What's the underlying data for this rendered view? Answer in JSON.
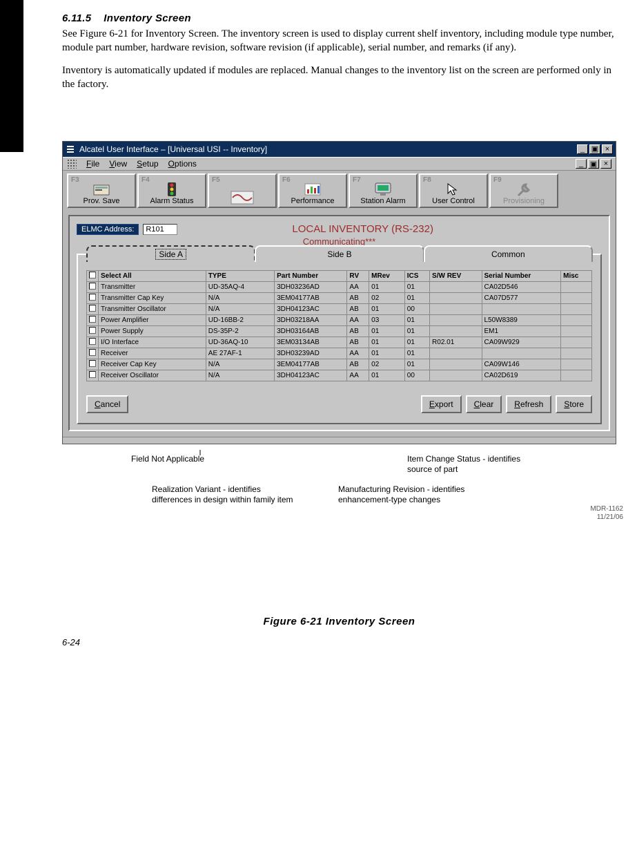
{
  "doc": {
    "section_num": "6.11.5",
    "section_title": "Inventory Screen",
    "para1": "See Figure 6-21 for Inventory Screen. The inventory screen is used to display current shelf inventory, including module type number, module part number, hardware revision, software revision (if applicable), serial number, and remarks (if any).",
    "para2": "Inventory is automatically updated if modules are replaced. Manual changes to the inventory list on the screen are performed only in the factory.",
    "figure_caption": "Figure 6-21  Inventory Screen",
    "page_number": "6-24",
    "mdr_ref": "MDR-1162",
    "mdr_date": "11/21/06"
  },
  "window": {
    "title": "Alcatel User Interface – [Universal USI -- Inventory]",
    "menus": {
      "file": "File",
      "view": "View",
      "setup": "Setup",
      "options": "Options"
    },
    "toolbar": [
      {
        "fkey": "F3",
        "label": "Prov. Save",
        "icon": "save-icon"
      },
      {
        "fkey": "F4",
        "label": "Alarm Status",
        "icon": "traffic-light-icon"
      },
      {
        "fkey": "F5",
        "label": "",
        "icon": "wave-icon"
      },
      {
        "fkey": "F6",
        "label": "Performance",
        "icon": "bar-chart-icon"
      },
      {
        "fkey": "F7",
        "label": "Station Alarm",
        "icon": "monitor-icon"
      },
      {
        "fkey": "F8",
        "label": "User Control",
        "icon": "pointer-icon"
      },
      {
        "fkey": "F9",
        "label": "Provisioning",
        "icon": "wrench-icon",
        "disabled": true
      }
    ],
    "elmc_label": "ELMC Address:",
    "elmc_value": "R101",
    "local_title": "LOCAL INVENTORY (RS-232)",
    "comm_status": "Communicating***",
    "tabs": {
      "a": "Side A",
      "b": "Side B",
      "c": "Common"
    },
    "columns": [
      "Select All",
      "TYPE",
      "Part Number",
      "RV",
      "MRev",
      "ICS",
      "S/W REV",
      "Serial Number",
      "Misc"
    ],
    "rows": [
      {
        "name": "Transmitter",
        "type": "UD-35AQ-4",
        "part": "3DH03236AD",
        "rv": "AA",
        "mrev": "01",
        "ics": "01",
        "sw": "",
        "serial": "CA02D546",
        "misc": ""
      },
      {
        "name": "Transmitter Cap Key",
        "type": "N/A",
        "part": "3EM04177AB",
        "rv": "AB",
        "mrev": "02",
        "ics": "01",
        "sw": "",
        "serial": "CA07D577",
        "misc": ""
      },
      {
        "name": "Transmitter Oscillator",
        "type": "N/A",
        "part": "3DH04123AC",
        "rv": "AB",
        "mrev": "01",
        "ics": "00",
        "sw": "",
        "serial": "",
        "misc": ""
      },
      {
        "name": "Power Amplifier",
        "type": "UD-16BB-2",
        "part": "3DH03218AA",
        "rv": "AA",
        "mrev": "03",
        "ics": "01",
        "sw": "",
        "serial": "L50W8389",
        "misc": ""
      },
      {
        "name": "Power Supply",
        "type": "DS-35P-2",
        "part": "3DH03164AB",
        "rv": "AB",
        "mrev": "01",
        "ics": "01",
        "sw": "",
        "serial": "EM1",
        "misc": ""
      },
      {
        "name": "I/O Interface",
        "type": "UD-36AQ-10",
        "part": "3EM03134AB",
        "rv": "AB",
        "mrev": "01",
        "ics": "01",
        "sw": "R02.01",
        "serial": "CA09W929",
        "misc": ""
      },
      {
        "name": "Receiver",
        "type": "AE 27AF-1",
        "part": "3DH03239AD",
        "rv": "AA",
        "mrev": "01",
        "ics": "01",
        "sw": "",
        "serial": "",
        "misc": ""
      },
      {
        "name": "Receiver Cap Key",
        "type": "N/A",
        "part": "3EM04177AB",
        "rv": "AB",
        "mrev": "02",
        "ics": "01",
        "sw": "",
        "serial": "CA09W146",
        "misc": ""
      },
      {
        "name": "Receiver Oscillator",
        "type": "N/A",
        "part": "3DH04123AC",
        "rv": "AA",
        "mrev": "01",
        "ics": "00",
        "sw": "",
        "serial": "CA02D619",
        "misc": ""
      }
    ],
    "buttons": {
      "cancel": "Cancel",
      "export": "Export",
      "clear": "Clear",
      "refresh": "Refresh",
      "store": "Store"
    }
  },
  "callouts": {
    "field_na": "Field Not Applicable",
    "rv": "Realization Variant - identifies differences in design within family item",
    "mrev": "Manufacturing Revision - identifies enhancement-type changes",
    "ics": "Item Change Status - identifies source of part"
  }
}
